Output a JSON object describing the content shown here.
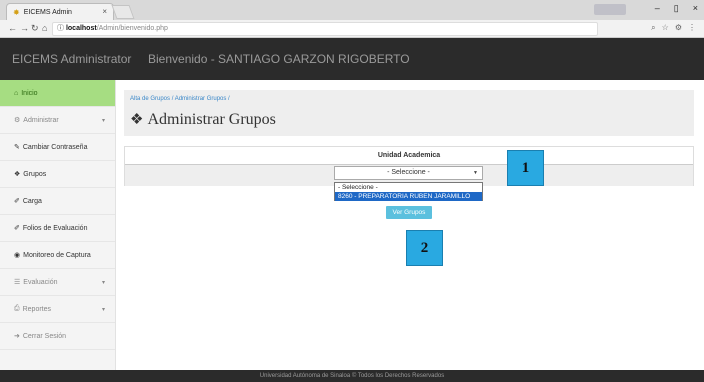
{
  "browser": {
    "tab_title": "EICEMS Admin",
    "tab_close": "×",
    "url_host": "localhost",
    "url_path": "/Admin/bienvenido.php",
    "win_user": "",
    "win_min": "–",
    "win_max": "▯",
    "win_close": "×"
  },
  "header": {
    "brand": "EICEMS Administrator",
    "welcome": "Bienvenido - SANTIAGO GARZON RIGOBERTO"
  },
  "sidebar": {
    "items": [
      {
        "label": "Inicio",
        "icon": "home-icon"
      },
      {
        "label": "Administrar",
        "icon": "gear-icon"
      },
      {
        "label": "Cambiar Contraseña",
        "icon": "pencil-icon"
      },
      {
        "label": "Grupos",
        "icon": "cubes-icon"
      },
      {
        "label": "Carga",
        "icon": "edit-icon"
      },
      {
        "label": "Folios de Evaluación",
        "icon": "edit-icon"
      },
      {
        "label": "Monitoreo de Captura",
        "icon": "eye-icon"
      },
      {
        "label": "Evaluación",
        "icon": "list-icon"
      },
      {
        "label": "Reportes",
        "icon": "print-icon"
      },
      {
        "label": "Cerrar Sesión",
        "icon": "signout-icon"
      }
    ]
  },
  "breadcrumb": {
    "text": "Alta de Grupos  /  Administrar Grupos  /"
  },
  "page": {
    "title": "Administrar Grupos"
  },
  "table": {
    "header": "Unidad Academica"
  },
  "select": {
    "value": "- Seleccione -",
    "options": [
      "- Seleccione -",
      "8260 - PREPARATORIA RUBEN JARAMILLO"
    ]
  },
  "button": {
    "label": "Ver Grupos"
  },
  "markers": {
    "one": "1",
    "two": "2"
  },
  "footer": {
    "text": "Universidad Autónoma de Sinaloa © Todos los Derechos Reservados"
  },
  "colors": {
    "accent": "#5bc0de",
    "active_nav": "#a6dd82",
    "header_bg": "#2b2b2b",
    "marker": "#29a9e1"
  }
}
